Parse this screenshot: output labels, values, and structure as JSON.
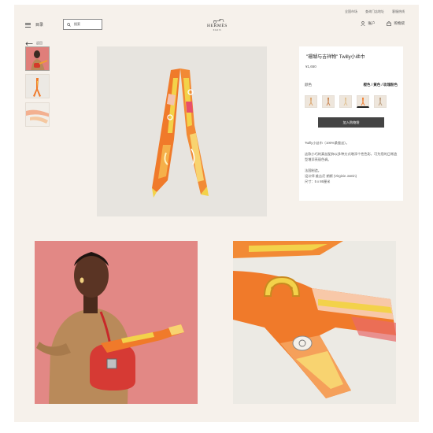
{
  "util_links": [
    "全国市场",
    "查询门店地址",
    "客服热线"
  ],
  "header": {
    "menu_label": "目录",
    "search_placeholder": "搜索",
    "brand": "HERMÈS",
    "city": "PARIS",
    "account_label": "账户",
    "cart_label": "购物袋"
  },
  "back_label": "返回",
  "product": {
    "title": "\"珊瑚与吉祥物\" Twilly小丝巾",
    "price": "¥1,650",
    "color_label": "颜色",
    "color_value": "橙色 / 黄色 / 玫瑰粉色",
    "add_to_bag": "加入购物袋",
    "desc_1": "Twilly小丝巾（100%桑蚕丝）。",
    "desc_2": "这款小巧的真丝配饰以多种方式增添个性色彩，可为您的日常造型增添亮丽色调。",
    "made_in": "法国制造。",
    "designer": "设计师 维吉尼 朗斯 (Virginie Jamin)",
    "size": "尺寸：5 x 86厘米"
  },
  "colors": {
    "page_bg": "#f6f1eb",
    "button": "#444444",
    "scarf_orange": "#f07a2a",
    "scarf_yellow": "#f3d24a",
    "pink_wall": "#e28885"
  },
  "icons": [
    "menu-icon",
    "search-icon",
    "account-icon",
    "bag-icon",
    "arrow-left-icon"
  ]
}
